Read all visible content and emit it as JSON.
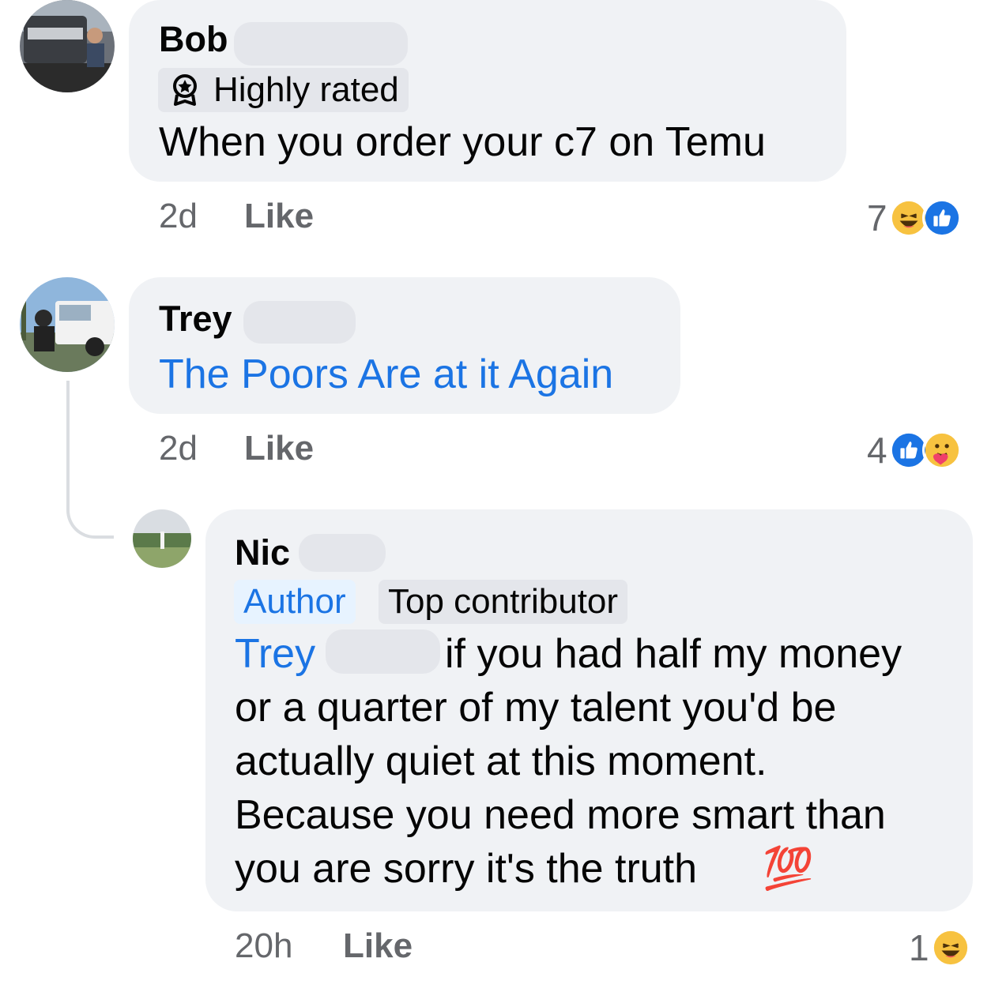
{
  "comments": [
    {
      "author": "Bob",
      "badges": [
        {
          "label": "Highly rated",
          "icon": "award-icon"
        }
      ],
      "text": "When you order your c7 on Temu",
      "time": "2d",
      "like_label": "Like",
      "reaction_count": "7",
      "reactions": [
        "haha-icon",
        "like-icon"
      ]
    },
    {
      "author": "Trey",
      "text": "The Poors Are at it Again",
      "time": "2d",
      "like_label": "Like",
      "reaction_count": "4",
      "reactions": [
        "like-icon",
        "care-icon"
      ]
    },
    {
      "author": "Nic",
      "badges": [
        {
          "label": "Author"
        },
        {
          "label": "Top contributor"
        }
      ],
      "mention": "Trey",
      "text_line1": "if you had half my money",
      "text_lines": [
        "or a quarter of my talent you'd be",
        "actually quiet at this moment.",
        "Because you need more smart than",
        "you are sorry it's the truth"
      ],
      "emoji": "💯",
      "time": "20h",
      "like_label": "Like",
      "reaction_count": "1",
      "reactions": [
        "haha-icon"
      ]
    }
  ],
  "colors": {
    "bubble": "#f0f2f5",
    "link": "#1b74e4",
    "meta": "#65676b",
    "like_blue": "#1b74e4",
    "haha_yellow": "#f7c240"
  }
}
